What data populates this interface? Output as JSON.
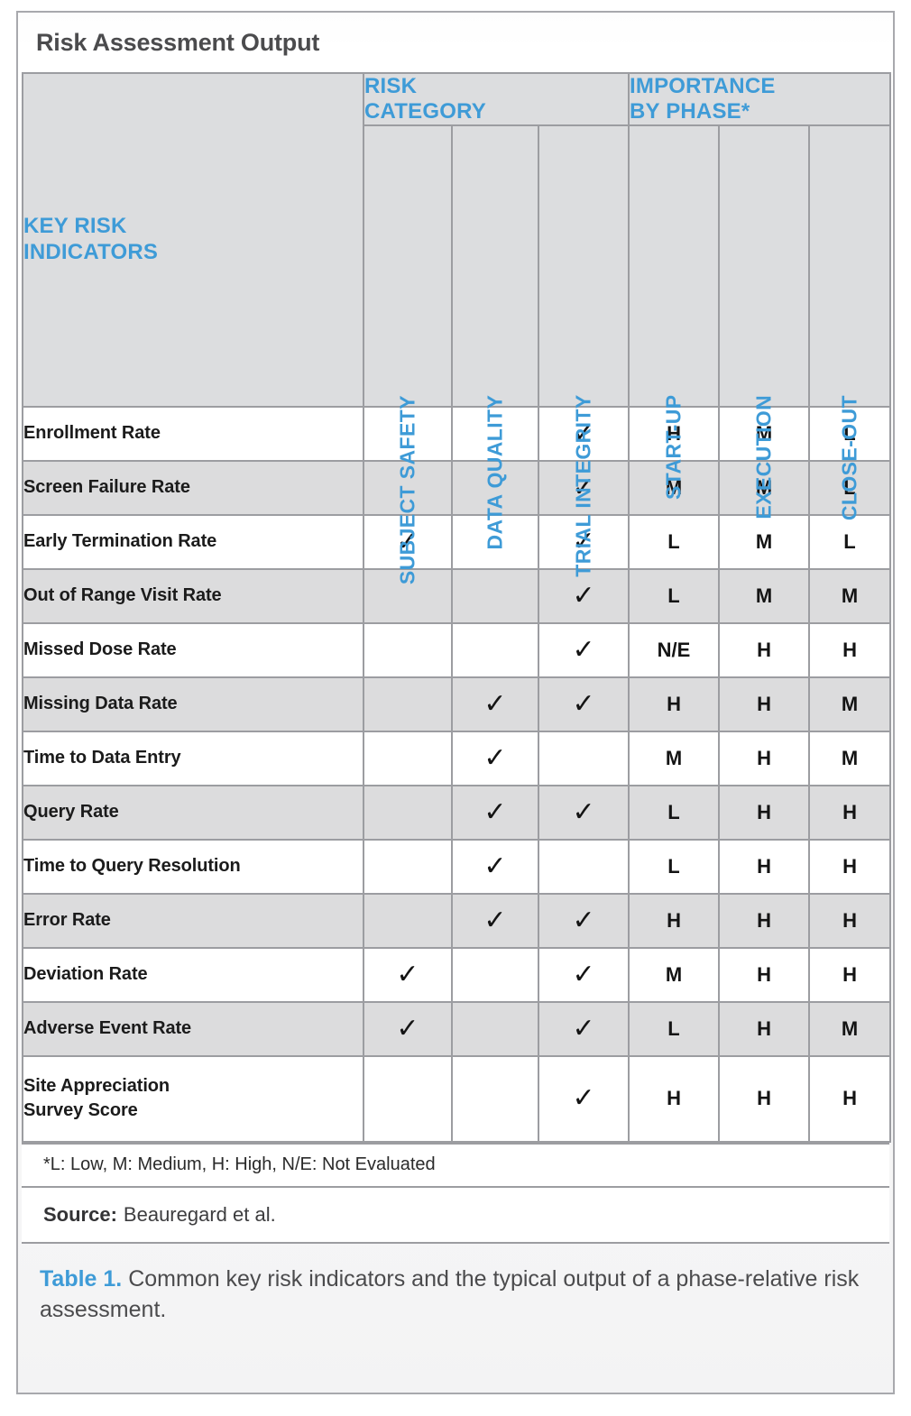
{
  "panel": {
    "title": "Risk Assessment Output"
  },
  "colors": {
    "accent_blue": "#3E9BD7",
    "header_gray": "#DCDDDF",
    "row_alt_gray": "#DCDCDD",
    "border_gray": "#9C9DA1",
    "text_dark": "#1B1B1B"
  },
  "table": {
    "group_headers": {
      "key_risk_indicators": "KEY RISK\nINDICATORS",
      "risk_category": "RISK\nCATEGORY",
      "importance_by_phase": "IMPORTANCE\nBY PHASE*"
    },
    "columns": [
      {
        "key": "kri",
        "label": "KEY RISK INDICATORS",
        "orientation": "horizontal"
      },
      {
        "key": "subject_safety",
        "label": "SUBJECT SAFETY",
        "orientation": "vertical",
        "group": "RISK CATEGORY"
      },
      {
        "key": "data_quality",
        "label": "DATA QUALITY",
        "orientation": "vertical",
        "group": "RISK CATEGORY"
      },
      {
        "key": "trial_integrity",
        "label": "TRIAL INTEGRITY",
        "orientation": "vertical",
        "group": "RISK CATEGORY"
      },
      {
        "key": "start_up",
        "label": "START-UP",
        "orientation": "vertical",
        "group": "IMPORTANCE BY PHASE*"
      },
      {
        "key": "execution",
        "label": "EXECUTION",
        "orientation": "vertical",
        "group": "IMPORTANCE BY PHASE*"
      },
      {
        "key": "close_out",
        "label": "CLOSE-OUT",
        "orientation": "vertical",
        "group": "IMPORTANCE BY PHASE*"
      }
    ],
    "check_glyph": "✓",
    "rows": [
      {
        "name": "Enrollment Rate",
        "subject_safety": "",
        "data_quality": "",
        "trial_integrity": "✓",
        "start_up": "H",
        "execution": "M",
        "close_out": "L"
      },
      {
        "name": "Screen Failure Rate",
        "subject_safety": "",
        "data_quality": "",
        "trial_integrity": "✓",
        "start_up": "M",
        "execution": "M",
        "close_out": "L"
      },
      {
        "name": "Early Termination Rate",
        "subject_safety": "✓",
        "data_quality": "",
        "trial_integrity": "✓",
        "start_up": "L",
        "execution": "M",
        "close_out": "L"
      },
      {
        "name": "Out of Range Visit Rate",
        "subject_safety": "",
        "data_quality": "",
        "trial_integrity": "✓",
        "start_up": "L",
        "execution": "M",
        "close_out": "M"
      },
      {
        "name": "Missed Dose Rate",
        "subject_safety": "",
        "data_quality": "",
        "trial_integrity": "✓",
        "start_up": "N/E",
        "execution": "H",
        "close_out": "H"
      },
      {
        "name": "Missing Data Rate",
        "subject_safety": "",
        "data_quality": "✓",
        "trial_integrity": "✓",
        "start_up": "H",
        "execution": "H",
        "close_out": "M"
      },
      {
        "name": "Time to Data Entry",
        "subject_safety": "",
        "data_quality": "✓",
        "trial_integrity": "",
        "start_up": "M",
        "execution": "H",
        "close_out": "M"
      },
      {
        "name": "Query Rate",
        "subject_safety": "",
        "data_quality": "✓",
        "trial_integrity": "✓",
        "start_up": "L",
        "execution": "H",
        "close_out": "H"
      },
      {
        "name": "Time to Query Resolution",
        "subject_safety": "",
        "data_quality": "✓",
        "trial_integrity": "",
        "start_up": "L",
        "execution": "H",
        "close_out": "H"
      },
      {
        "name": "Error Rate",
        "subject_safety": "",
        "data_quality": "✓",
        "trial_integrity": "✓",
        "start_up": "H",
        "execution": "H",
        "close_out": "H"
      },
      {
        "name": "Deviation Rate",
        "subject_safety": "✓",
        "data_quality": "",
        "trial_integrity": "✓",
        "start_up": "M",
        "execution": "H",
        "close_out": "H"
      },
      {
        "name": "Adverse Event Rate",
        "subject_safety": "✓",
        "data_quality": "",
        "trial_integrity": "✓",
        "start_up": "L",
        "execution": "H",
        "close_out": "M"
      },
      {
        "name": "Site Appreciation",
        "name_line2": "Survey Score",
        "subject_safety": "",
        "data_quality": "",
        "trial_integrity": "✓",
        "start_up": "H",
        "execution": "H",
        "close_out": "H"
      }
    ]
  },
  "footnote": "*L: Low, M: Medium, H: High, N/E: Not Evaluated",
  "source": {
    "label": "Source:",
    "value": "Beauregard et al."
  },
  "caption": {
    "number": "Table 1.",
    "text": " Common key risk indicators and the typical output of a phase-relative risk assessment."
  }
}
